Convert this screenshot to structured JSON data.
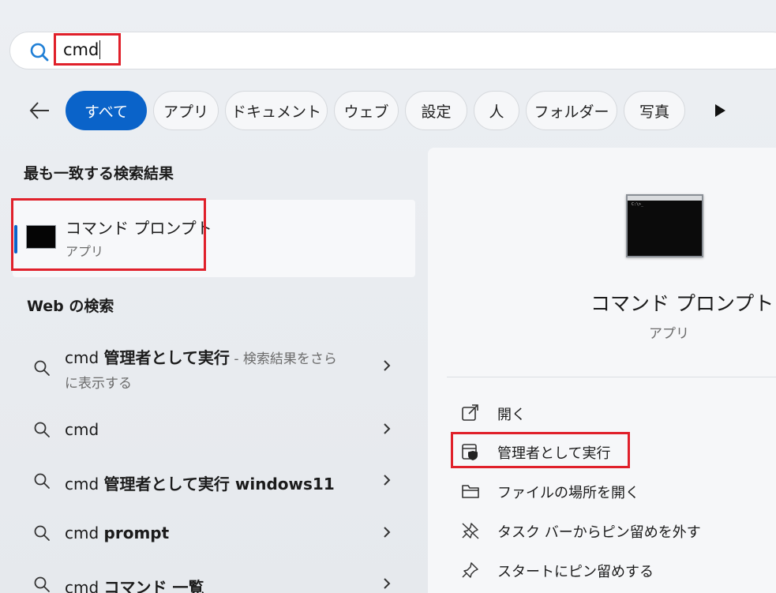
{
  "search": {
    "query": "cmd"
  },
  "filters": {
    "chips": [
      "すべて",
      "アプリ",
      "ドキュメント",
      "ウェブ",
      "設定",
      "人",
      "フォルダー",
      "写真"
    ],
    "active_index": 0
  },
  "best_match": {
    "heading": "最も一致する検索結果",
    "title": "コマンド プロンプト",
    "type": "アプリ"
  },
  "web": {
    "heading": "Web の検索",
    "results": [
      {
        "prefix": "cmd ",
        "bold": "管理者として実行",
        "suffix": " - 検索結果をさら",
        "line2": "に表示する"
      },
      {
        "prefix": "cmd",
        "bold": "",
        "suffix": "",
        "line2": ""
      },
      {
        "prefix": "cmd ",
        "bold": "管理者として実行 windows11",
        "suffix": "",
        "line2": ""
      },
      {
        "prefix": "cmd ",
        "bold": "prompt",
        "suffix": "",
        "line2": ""
      },
      {
        "prefix": "cmd ",
        "bold": "コマンド 一覧",
        "suffix": "",
        "line2": ""
      }
    ]
  },
  "preview": {
    "title": "コマンド プロンプト",
    "type": "アプリ",
    "thumb_text": "C:\\>_",
    "actions": [
      {
        "label": "開く",
        "icon": "open-external-icon"
      },
      {
        "label": "管理者として実行",
        "icon": "shield-admin-icon"
      },
      {
        "label": "ファイルの場所を開く",
        "icon": "folder-icon"
      },
      {
        "label": "タスク バーからピン留めを外す",
        "icon": "unpin-icon"
      },
      {
        "label": "スタートにピン留めする",
        "icon": "pin-icon"
      }
    ]
  },
  "colors": {
    "accent": "#0a63c9",
    "highlight": "#e0202a"
  }
}
